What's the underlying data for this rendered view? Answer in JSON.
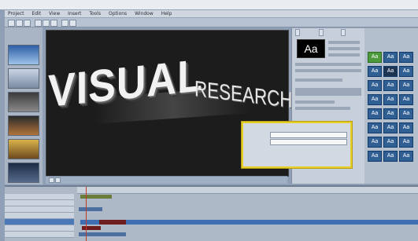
{
  "app": {
    "menu_items": [
      "Project",
      "Edit",
      "View",
      "Insert",
      "Tools",
      "Options",
      "Window",
      "Help"
    ]
  },
  "preview": {
    "headline_word": "VISUAL",
    "subtitle_word": "RESEARCH"
  },
  "properties_panel": {
    "tabs": [
      "",
      "",
      ""
    ],
    "font_preview": "Aa"
  },
  "text_styles": {
    "tile_label": "Aa",
    "tiles": [
      {
        "label": "Aa",
        "style": "green"
      },
      {
        "label": "Aa",
        "style": "blue"
      },
      {
        "label": "Aa",
        "style": "blue"
      },
      {
        "label": "Aa",
        "style": "blue"
      },
      {
        "label": "Aa",
        "style": "dark"
      },
      {
        "label": "Aa",
        "style": "blue"
      },
      {
        "label": "Aa",
        "style": "blue"
      },
      {
        "label": "Aa",
        "style": "blue"
      },
      {
        "label": "Aa",
        "style": "blue"
      },
      {
        "label": "Aa",
        "style": "blue"
      },
      {
        "label": "Aa",
        "style": "blue"
      },
      {
        "label": "Aa",
        "style": "blue"
      },
      {
        "label": "Aa",
        "style": "blue"
      },
      {
        "label": "Aa",
        "style": "blue"
      },
      {
        "label": "Aa",
        "style": "blue"
      },
      {
        "label": "Aa",
        "style": "blue"
      },
      {
        "label": "Aa",
        "style": "blue"
      },
      {
        "label": "Aa",
        "style": "blue"
      },
      {
        "label": "Aa",
        "style": "blue"
      },
      {
        "label": "Aa",
        "style": "blue"
      },
      {
        "label": "Aa",
        "style": "blue"
      },
      {
        "label": "Aa",
        "style": "blue"
      },
      {
        "label": "Aa",
        "style": "blue"
      },
      {
        "label": "Aa",
        "style": "blue"
      }
    ]
  },
  "dialog": {
    "rows": [
      "",
      "",
      "",
      "",
      ""
    ]
  },
  "colors": {
    "highlight_border": "#e6cf2a",
    "selected_track": "#4a78b8",
    "playhead": "#c0392b"
  }
}
